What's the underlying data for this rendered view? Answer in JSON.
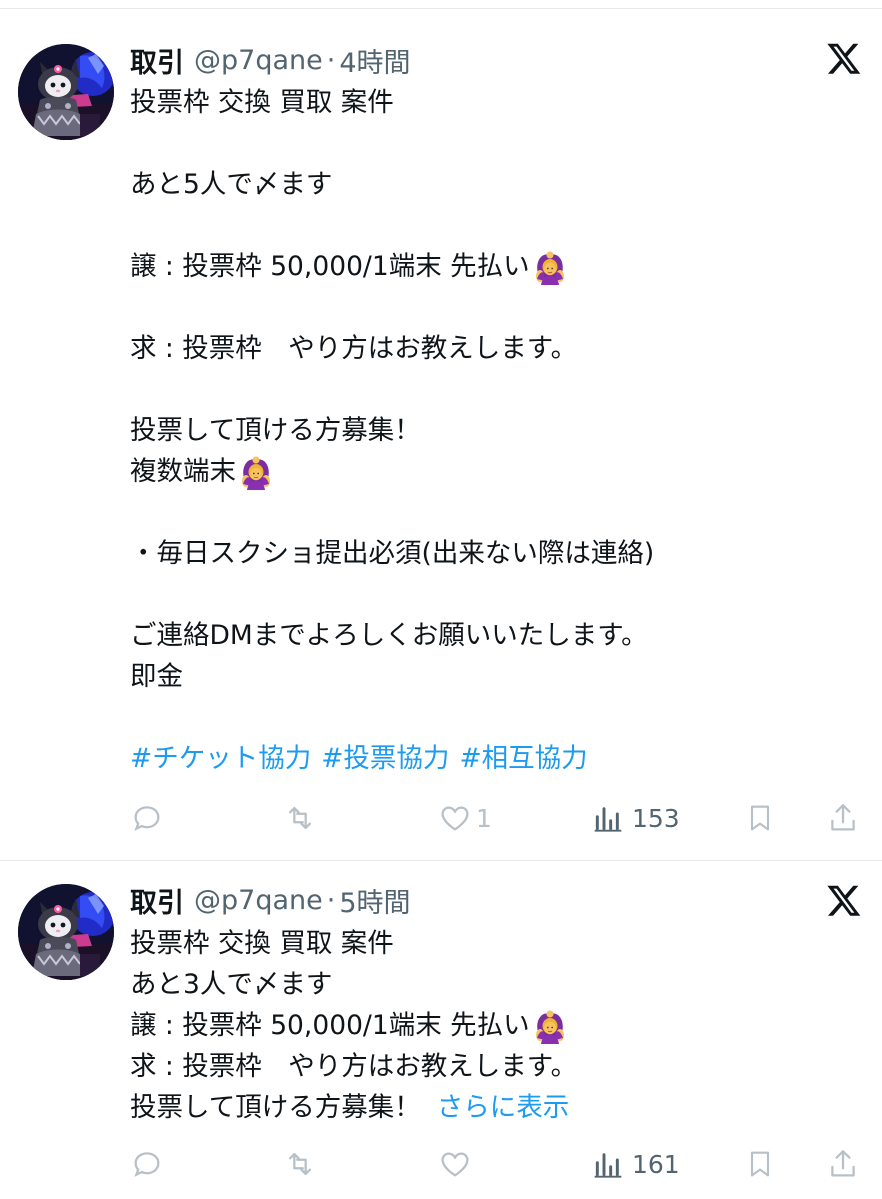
{
  "tweets": [
    {
      "author_name": "取引",
      "handle": "@p7qane",
      "separator": "·",
      "time": "4時間",
      "lines": {
        "l1": "投票枠 交換 買取 案件",
        "l2": "あと5人で〆ます",
        "l3": "譲 : 投票枠 50,000/1端末 先払い",
        "l4": "求 : 投票枠　やり方はお教えします。",
        "l5": "投票して頂ける方募集！",
        "l6": "複数端末",
        "l7": "・毎日スクショ提出必須(出来ない際は連絡)",
        "l8": "ご連絡DMまでよろしくお願いいたします。",
        "l9": "即金"
      },
      "hashtags": [
        "#チケット協力",
        "#投票協力",
        "#相互協力"
      ],
      "stats": {
        "replies": "",
        "reposts": "",
        "likes": "1",
        "views": "153"
      }
    },
    {
      "author_name": "取引",
      "handle": "@p7qane",
      "separator": "·",
      "time": "5時間",
      "lines": {
        "l1": "投票枠 交換 買取 案件",
        "l2": "あと3人で〆ます",
        "l3": "譲 : 投票枠 50,000/1端末  先払い",
        "l4": "求 : 投票枠　やり方はお教えします。",
        "l5": "投票して頂ける方募集！"
      },
      "show_more": "さらに表示",
      "stats": {
        "replies": "",
        "reposts": "",
        "likes": "",
        "views": "161"
      }
    }
  ],
  "icons": {
    "platform": "x-logo-icon",
    "reply": "reply-icon",
    "repost": "repost-icon",
    "like": "heart-icon",
    "views": "views-icon",
    "bookmark": "bookmark-icon",
    "share": "share-icon",
    "emoji": "person-gesturing-ok-emoji"
  },
  "colors": {
    "link": "#1d9bf0",
    "text": "#0f1419",
    "muted": "#536471",
    "icon_light": "#b8c0c7",
    "divider": "#e6e9eb"
  }
}
